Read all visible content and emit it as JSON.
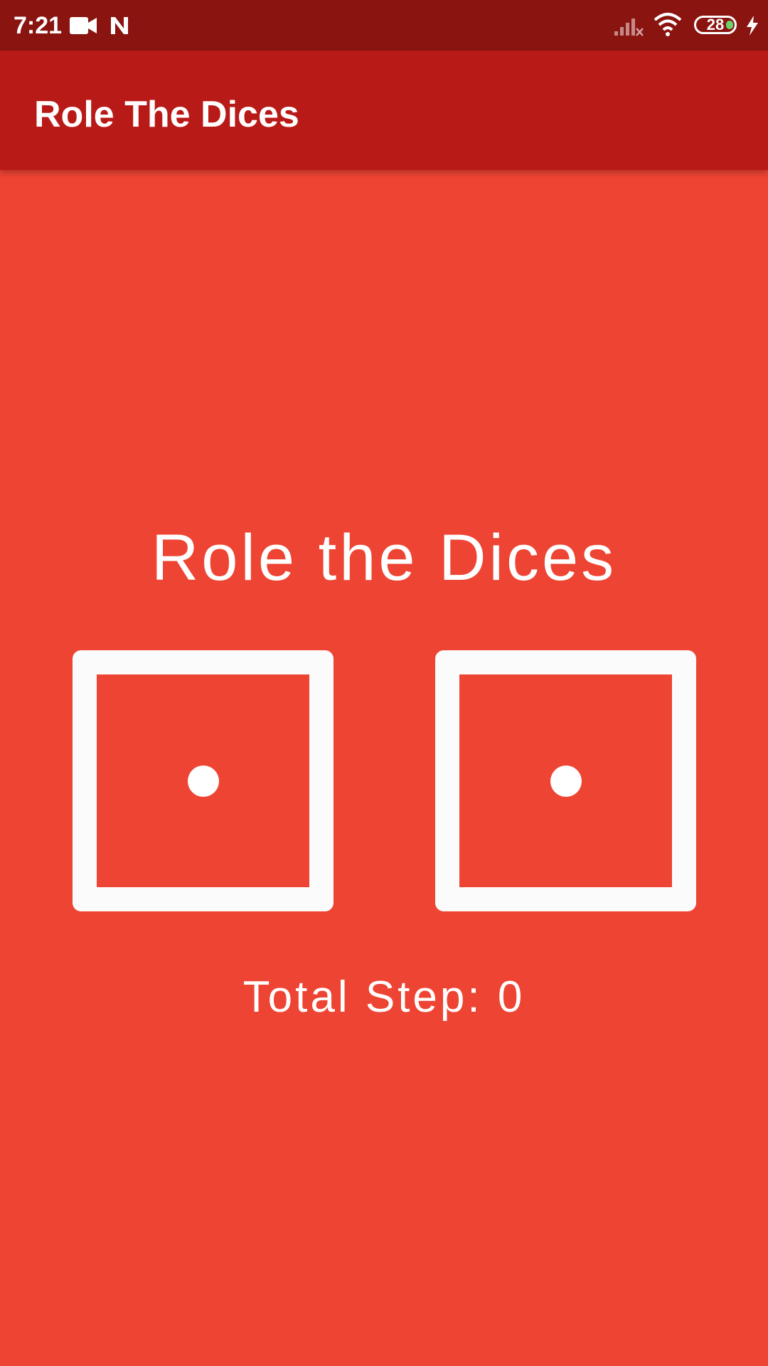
{
  "status_bar": {
    "time": "7:21",
    "battery_level": "28",
    "icons": [
      "video-camera-icon",
      "n-app-icon",
      "signal-icon",
      "wifi-icon",
      "battery-icon",
      "charging-bolt-icon"
    ]
  },
  "app_bar": {
    "title": "Role The Dices"
  },
  "main": {
    "heading": "Role the Dices",
    "dice": [
      {
        "value": 1
      },
      {
        "value": 1
      }
    ],
    "total_step_label": "Total Step: 0"
  },
  "colors": {
    "background": "#ee4433",
    "app_bar": "#b81a17",
    "status_bar": "#8a1410",
    "foreground": "#ffffff"
  }
}
